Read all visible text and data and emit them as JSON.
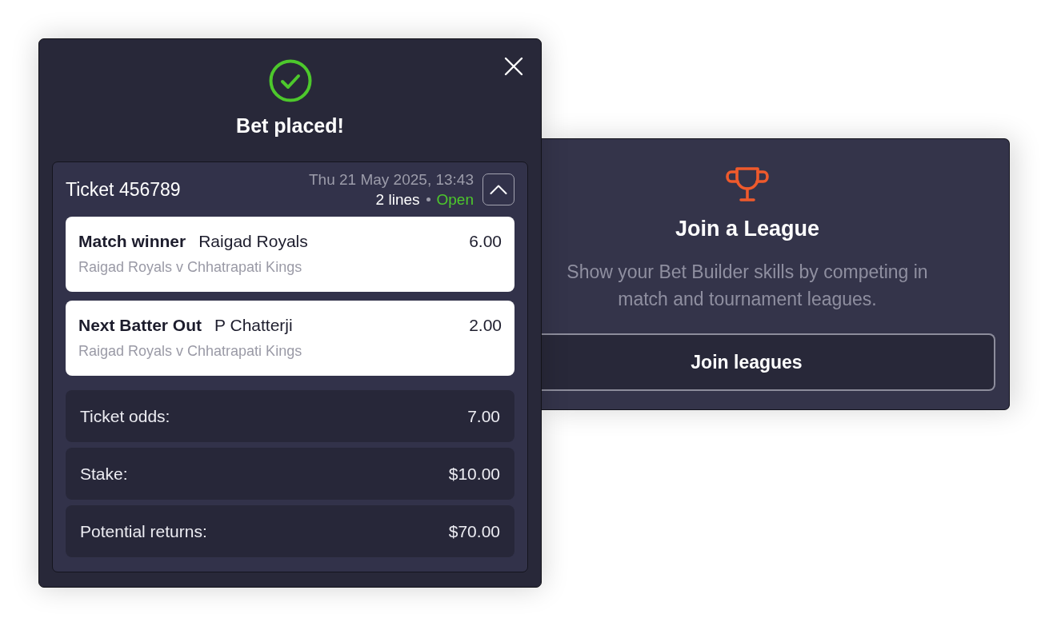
{
  "bet_confirmation": {
    "title": "Bet placed!",
    "ticket": {
      "label": "Ticket 456789",
      "date": "Thu 21 May 2025, 13:43",
      "lines": "2 lines",
      "status": "Open",
      "expanded": true,
      "selections": [
        {
          "market": "Match winner",
          "selection": "Raigad Royals",
          "odds": "6.00",
          "event": "Raigad Royals v Chhatrapati Kings"
        },
        {
          "market": "Next Batter Out",
          "selection": "P Chatterji",
          "odds": "2.00",
          "event": "Raigad Royals v Chhatrapati Kings"
        }
      ],
      "summary": [
        {
          "label": "Ticket odds:",
          "value": "7.00"
        },
        {
          "label": "Stake:",
          "value": "$10.00"
        },
        {
          "label": "Potential returns:",
          "value": "$70.00"
        }
      ]
    }
  },
  "league_promo": {
    "title": "Join a League",
    "description": "Show your Bet Builder skills by competing in match and tournament leagues.",
    "button": "Join leagues"
  }
}
